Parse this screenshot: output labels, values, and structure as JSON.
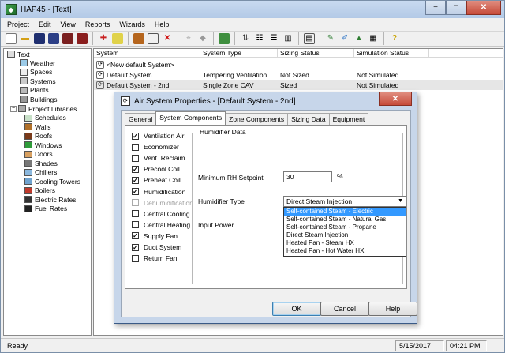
{
  "window": {
    "title": "HAP45 - [Text]",
    "minimize": "−",
    "maximize": "□",
    "close": "✕"
  },
  "menu": [
    "Project",
    "Edit",
    "View",
    "Reports",
    "Wizards",
    "Help"
  ],
  "tree": {
    "root": "Text",
    "items": [
      "Weather",
      "Spaces",
      "Systems",
      "Plants",
      "Buildings"
    ],
    "libraries": "Project Libraries",
    "library_items": [
      "Schedules",
      "Walls",
      "Roofs",
      "Windows",
      "Doors",
      "Shades",
      "Chillers",
      "Cooling Towers",
      "Boilers",
      "Electric Rates",
      "Fuel Rates"
    ]
  },
  "list": {
    "columns": [
      "System",
      "System Type",
      "Sizing Status",
      "Simulation Status"
    ],
    "rows": [
      {
        "system": "<New default System>",
        "type": "",
        "sizing": "",
        "simulation": ""
      },
      {
        "system": "Default System",
        "type": "Tempering Ventilation",
        "sizing": "Not Sized",
        "simulation": "Not Simulated"
      },
      {
        "system": "Default System - 2nd",
        "type": "Single Zone CAV",
        "sizing": "Sized",
        "simulation": "Not Simulated"
      }
    ]
  },
  "dialog": {
    "title": "Air System Properties - [Default System - 2nd]",
    "close": "✕",
    "tabs": [
      "General",
      "System Components",
      "Zone Components",
      "Sizing Data",
      "Equipment"
    ],
    "active_tab": "System Components",
    "components": [
      {
        "label": "Ventilation Air",
        "checked": true,
        "enabled": true
      },
      {
        "label": "Economizer",
        "checked": false,
        "enabled": true
      },
      {
        "label": "Vent. Reclaim",
        "checked": false,
        "enabled": true
      },
      {
        "label": "Precool Coil",
        "checked": true,
        "enabled": true
      },
      {
        "label": "Preheat Coil",
        "checked": true,
        "enabled": true
      },
      {
        "label": "Humidification",
        "checked": true,
        "enabled": true
      },
      {
        "label": "Dehumidification",
        "checked": false,
        "enabled": false
      },
      {
        "label": "Central Cooling",
        "checked": false,
        "enabled": true
      },
      {
        "label": "Central Heating",
        "checked": false,
        "enabled": true
      },
      {
        "label": "Supply Fan",
        "checked": true,
        "enabled": true
      },
      {
        "label": "Duct System",
        "checked": true,
        "enabled": true
      },
      {
        "label": "Return Fan",
        "checked": false,
        "enabled": true
      }
    ],
    "group_title": "Humidifier Data",
    "min_rh_label": "Minimum RH Setpoint",
    "min_rh_value": "30",
    "min_rh_unit": "%",
    "humidifier_type_label": "Humidifier Type",
    "humidifier_type_value": "Direct Steam Injection",
    "humidifier_options": [
      "Self-contained Steam - Electric",
      "Self-contained Steam - Natural Gas",
      "Self-contained Steam - Propane",
      "Direct Steam Injection",
      "Heated Pan - Steam HX",
      "Heated Pan - Hot Water HX"
    ],
    "highlighted_option": 0,
    "input_power_label": "Input Power",
    "ok": "OK",
    "cancel": "Cancel",
    "help": "Help"
  },
  "status": {
    "text": "Ready",
    "date": "5/15/2017",
    "time": "04:21 PM"
  },
  "colors": {
    "selection": "#3399ff",
    "title_bar": "#b3c9e6",
    "close": "#c64b3a"
  }
}
